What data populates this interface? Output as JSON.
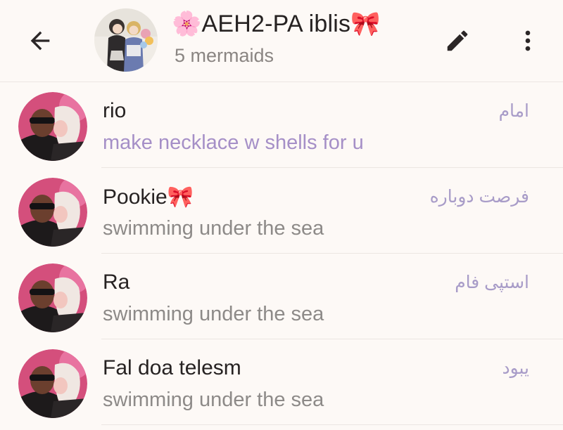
{
  "header": {
    "title": "🌸AEH2-PA iblis🎀",
    "subtitle": "5 mermaids"
  },
  "icons": {
    "back": "arrow-left-icon",
    "edit": "pencil-icon",
    "more": "more-vertical-icon"
  },
  "colors": {
    "background": "#fdf9f6",
    "accent_status": "#a58fc7",
    "role_text": "#a89cc8",
    "secondary_text": "#8d8a88"
  },
  "members": [
    {
      "name": "rio",
      "status": "make necklace w shells for u",
      "role": "امام"
    },
    {
      "name": "Pookie🎀",
      "status": "swimming under the sea",
      "role": "فرصت دوباره"
    },
    {
      "name": "Ra",
      "status": "swimming under the sea",
      "role": "استپی فام"
    },
    {
      "name": "Fal doa telesm",
      "status": "swimming under the sea",
      "role": "یبود"
    }
  ]
}
